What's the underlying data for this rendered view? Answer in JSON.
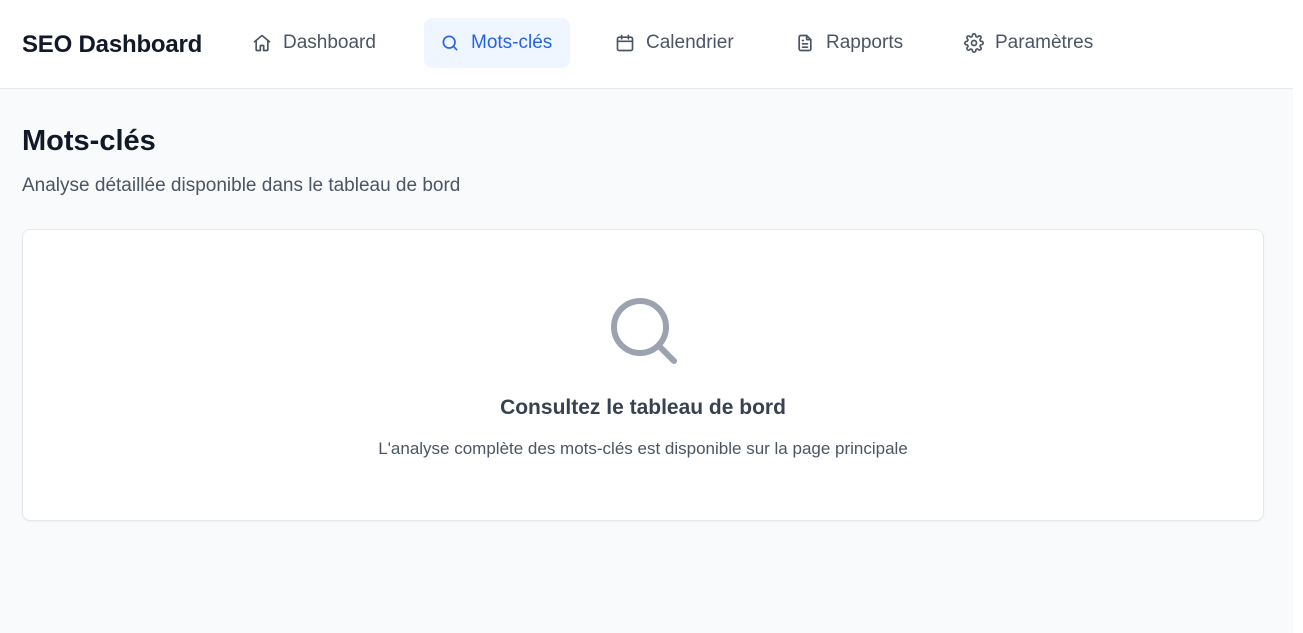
{
  "brand": "SEO Dashboard",
  "nav": {
    "dashboard": "Dashboard",
    "keywords": "Mots-clés",
    "calendar": "Calendrier",
    "reports": "Rapports",
    "settings": "Paramètres",
    "active": "keywords"
  },
  "page": {
    "title": "Mots-clés",
    "subtitle": "Analyse détaillée disponible dans le tableau de bord"
  },
  "empty_state": {
    "icon": "search-icon",
    "title": "Consultez le tableau de bord",
    "text": "L'analyse complète des mots-clés est disponible sur la page principale"
  },
  "colors": {
    "accent": "#2563eb",
    "accent_bg": "#eff6ff",
    "text_primary": "#111827",
    "text_muted": "#4b5563",
    "icon_muted": "#9ca3af",
    "background": "#f9fafb"
  }
}
